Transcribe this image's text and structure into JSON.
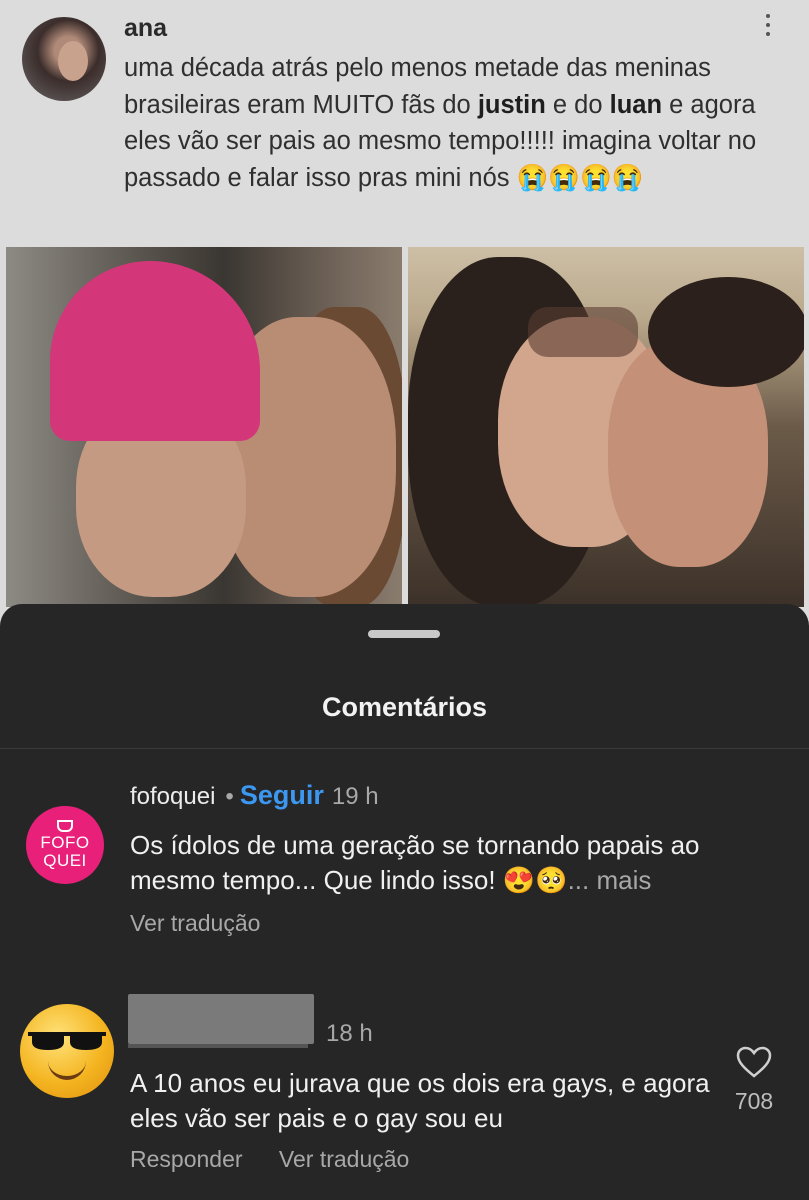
{
  "tweet": {
    "author": "ana",
    "text_parts": [
      {
        "t": "uma década atrás pelo menos metade das meninas brasileiras eram MUITO fãs do ",
        "b": false
      },
      {
        "t": "justin",
        "b": true
      },
      {
        "t": " e do ",
        "b": false
      },
      {
        "t": "luan",
        "b": true
      },
      {
        "t": " e agora eles vão ser pais ao mesmo tempo!!!!! imagina voltar no passado e falar isso pras mini nós 😭😭😭😭",
        "b": false
      }
    ]
  },
  "sheet": {
    "title": "Comentários"
  },
  "comments": [
    {
      "username": "fofoquei",
      "avatar_text": [
        "FOFO",
        "QUEI"
      ],
      "follow_label": "Seguir",
      "time": "19 h",
      "text": "Os ídolos de uma geração se tornando papais ao mesmo tempo... Que lindo isso! 😍🥺",
      "more_label": "... mais",
      "translate_label": "Ver tradução"
    },
    {
      "time": "18 h",
      "text": "A 10 anos eu jurava que os dois era gays, e agora eles vão ser pais e o gay sou eu",
      "reply_label": "Responder",
      "translate_label": "Ver tradução",
      "likes": "708"
    }
  ],
  "colors": {
    "sheet_bg": "#262626",
    "follow_blue": "#3b97f0",
    "brand_pink": "#e8207a"
  },
  "icons": [
    "more-vert-icon",
    "heart-icon",
    "sunglasses-emoji-avatar"
  ]
}
